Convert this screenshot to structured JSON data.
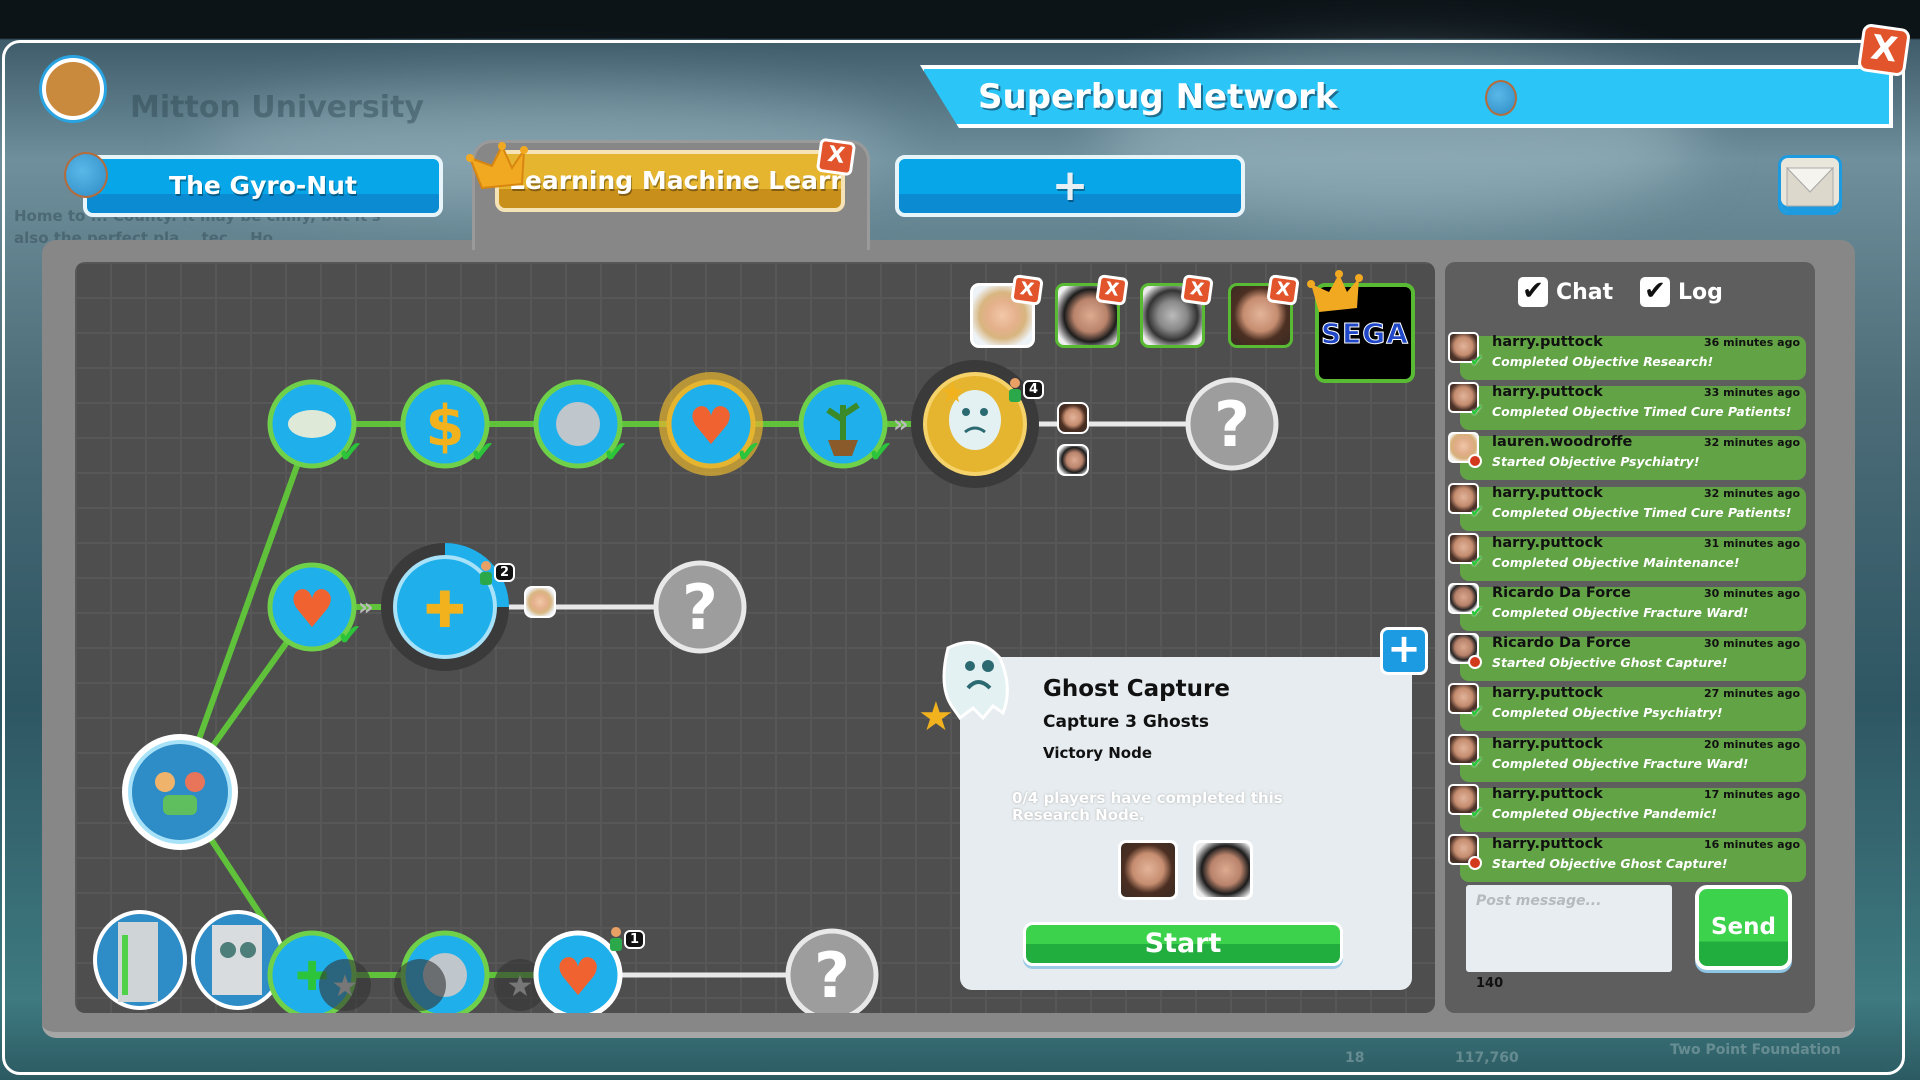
{
  "window": {
    "title": "Superbug Network",
    "close_label": "X"
  },
  "background": {
    "hospital_name": "Mitton University",
    "description": "Home to ... County. It may be chilly, but it's also the perfect pla... tec... Ho...",
    "bottom_values": [
      "18",
      "117,760"
    ],
    "bottom_label": "Two Point Foundation"
  },
  "tabs": [
    {
      "label": "The Gyro-Nut",
      "active": false,
      "icon": "globe-icon"
    },
    {
      "label": "Learning Machine Learning",
      "active": true,
      "icon": "crown-icon",
      "close_label": "X"
    },
    {
      "label": "+",
      "icon": "plus-icon"
    }
  ],
  "players": {
    "remove_label": "X",
    "count": 4,
    "owner_logo": "SEGA"
  },
  "graph": {
    "colors": {
      "path": "#5fc23a",
      "locked_path": "#e8e8e8",
      "node": "#1fb0ec",
      "victory": "#e6b52f",
      "unknown": "#9d9d9d"
    },
    "badges": {
      "ghost": "4",
      "puzzle": "2",
      "heart": "1"
    },
    "unknown_label": "?"
  },
  "popup": {
    "title": "Ghost Capture",
    "subtitle": "Capture 3 Ghosts",
    "kind": "Victory Node",
    "info": "0/4 players have completed this Research Node.",
    "start_label": "Start",
    "plus_label": "+"
  },
  "chat": {
    "tabs": [
      {
        "label": "Chat",
        "checked": true
      },
      {
        "label": "Log",
        "checked": true
      }
    ],
    "check_glyph": "✔",
    "messages": [
      {
        "name": "harry.puttock",
        "time": "36 minutes ago",
        "text": "Completed Objective Research!",
        "status": "completed",
        "avatar": "harry"
      },
      {
        "name": "harry.puttock",
        "time": "33 minutes ago",
        "text": "Completed Objective Timed Cure Patients!",
        "status": "completed",
        "avatar": "harry"
      },
      {
        "name": "lauren.woodroffe",
        "time": "32 minutes ago",
        "text": "Started Objective Psychiatry!",
        "status": "started",
        "avatar": "lauren"
      },
      {
        "name": "harry.puttock",
        "time": "32 minutes ago",
        "text": "Completed Objective Timed Cure Patients!",
        "status": "completed",
        "avatar": "harry"
      },
      {
        "name": "harry.puttock",
        "time": "31 minutes ago",
        "text": "Completed Objective Maintenance!",
        "status": "completed",
        "avatar": "harry"
      },
      {
        "name": "Ricardo Da Force",
        "time": "30 minutes ago",
        "text": "Completed Objective Fracture Ward!",
        "status": "completed",
        "avatar": "ricardo"
      },
      {
        "name": "Ricardo Da Force",
        "time": "30 minutes ago",
        "text": "Started Objective Ghost Capture!",
        "status": "started",
        "avatar": "ricardo"
      },
      {
        "name": "harry.puttock",
        "time": "27 minutes ago",
        "text": "Completed Objective Psychiatry!",
        "status": "completed",
        "avatar": "harry"
      },
      {
        "name": "harry.puttock",
        "time": "20 minutes ago",
        "text": "Completed Objective Fracture Ward!",
        "status": "completed",
        "avatar": "harry"
      },
      {
        "name": "harry.puttock",
        "time": "17 minutes ago",
        "text": "Completed Objective Pandemic!",
        "status": "completed",
        "avatar": "harry"
      },
      {
        "name": "harry.puttock",
        "time": "16 minutes ago",
        "text": "Started Objective Ghost Capture!",
        "status": "started",
        "avatar": "harry"
      }
    ],
    "input_placeholder": "Post message...",
    "char_count": "140",
    "send_label": "Send"
  }
}
